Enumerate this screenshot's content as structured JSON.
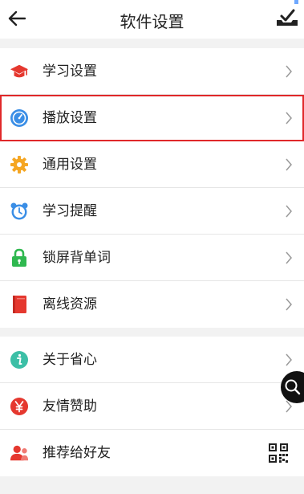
{
  "header": {
    "title": "软件设置",
    "back_icon": "arrow-left-icon",
    "right_icon": "check-tray-icon"
  },
  "group1": [
    {
      "label": "学习设置",
      "icon": "graduation-cap-icon",
      "color": "#e5382f"
    },
    {
      "label": "播放设置",
      "icon": "compass-icon",
      "color": "#3a8ee6",
      "selected": true
    },
    {
      "label": "通用设置",
      "icon": "gear-icon",
      "color": "#f5a623"
    },
    {
      "label": "学习提醒",
      "icon": "alarm-clock-icon",
      "color": "#3a8ee6"
    },
    {
      "label": "锁屏背单词",
      "icon": "lock-icon",
      "color": "#2fb84f"
    },
    {
      "label": "离线资源",
      "icon": "book-icon",
      "color": "#e5382f"
    }
  ],
  "group2": [
    {
      "label": "关于省心",
      "icon": "info-icon",
      "color": "#3cbfa6"
    },
    {
      "label": "友情赞助",
      "icon": "yen-icon",
      "color": "#e5382f"
    },
    {
      "label": "推荐给好友",
      "icon": "share-user-icon",
      "color": "#e5382f",
      "trailing": "qr-code-icon"
    }
  ],
  "floating_button": {
    "icon": "search-icon"
  },
  "colors": {
    "selection_border": "#e0282a",
    "background": "#f2f2f2"
  }
}
